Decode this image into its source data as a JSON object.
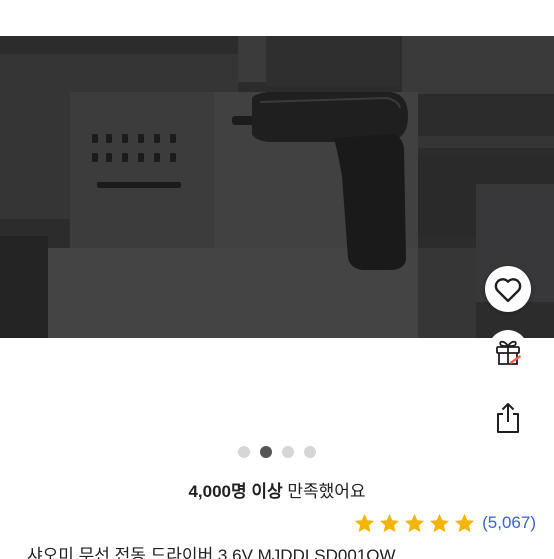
{
  "product_image": {
    "alt": ""
  },
  "actions": {
    "wishlist_icon": "heart-icon",
    "gift_icon": "gift-icon",
    "share_icon": "share-icon"
  },
  "carousel": {
    "total": 4,
    "active_index": 1
  },
  "satisfaction": {
    "count": "4,000명 이상",
    "suffix": " 만족했어요"
  },
  "rating": {
    "stars": 5,
    "star_color": "#f4b400",
    "count_text": "(5,067)",
    "count_color": "#3a63d6"
  },
  "product_title_partial": "샤오미 무선 전동 드라이버 3.6V MJDDLSD001QW"
}
